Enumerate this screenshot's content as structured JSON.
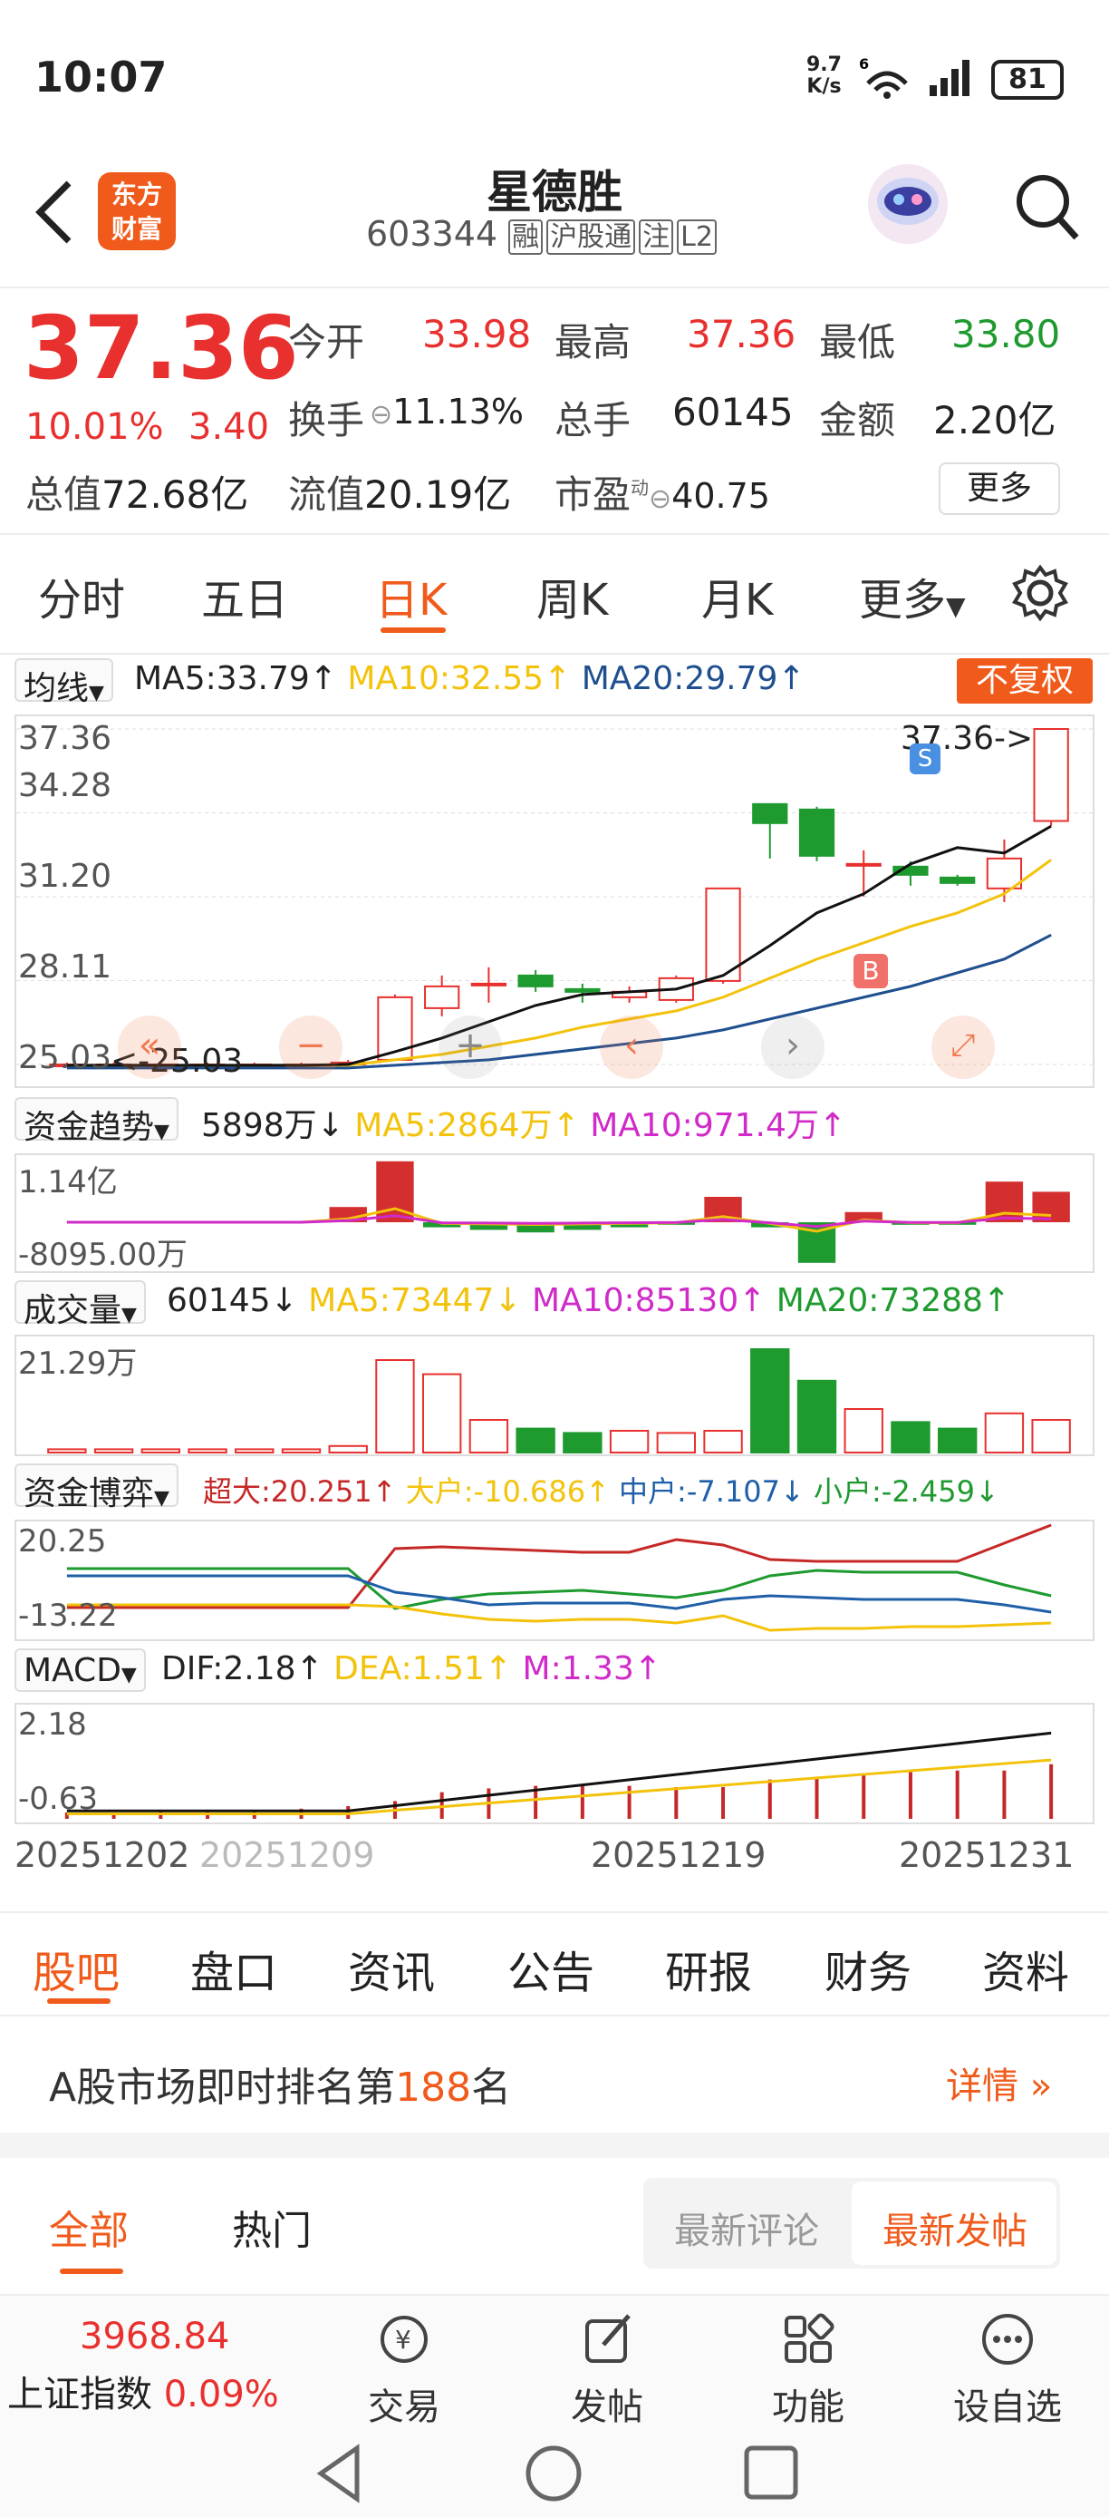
{
  "status": {
    "time": "10:07",
    "speed_top": "9.7",
    "speed_bottom": "K/s",
    "network": "6",
    "battery": "81"
  },
  "header": {
    "logo_line1": "东方",
    "logo_line2": "财富",
    "title": "星德胜",
    "code": "603344",
    "badges": [
      "融",
      "沪股通",
      "注",
      "L2"
    ]
  },
  "quote": {
    "price": "37.36",
    "change_pct": "10.01%",
    "change": "3.40",
    "open_label": "今开",
    "open": "33.98",
    "high_label": "最高",
    "high": "37.36",
    "low_label": "最低",
    "low": "33.80",
    "turnover_label": "换手",
    "turnover": "11.13%",
    "volume_label": "总手",
    "volume": "60145",
    "amount_label": "金额",
    "amount": "2.20亿",
    "mcap_label": "总值",
    "mcap": "72.68亿",
    "float_label": "流值",
    "float": "20.19亿",
    "pe_label": "市盈",
    "pe_sup": "动",
    "pe": "40.75",
    "more": "更多"
  },
  "period_tabs": [
    "分时",
    "五日",
    "日K",
    "周K",
    "月K",
    "更多"
  ],
  "ma": {
    "selector": "均线",
    "ma5": "MA5:33.79",
    "ma10": "MA10:32.55",
    "ma20": "MA20:29.79",
    "fq": "不复权",
    "prices": [
      "37.36",
      "34.28",
      "31.20",
      "28.11",
      "25.03"
    ],
    "last_label": "37.36->",
    "low_mark": "<-25.03",
    "buy": "B",
    "sell": "S"
  },
  "fund": {
    "selector": "资金趋势",
    "value": "5898万",
    "ma5": "MA5:2864万",
    "ma10": "MA10:971.4万",
    "top": "1.14亿",
    "bottom": "-8095.00万"
  },
  "vol": {
    "selector": "成交量",
    "value": "60145",
    "ma5": "MA5:73447",
    "ma10": "MA10:85130",
    "ma20": "MA20:73288",
    "top": "21.29万"
  },
  "game": {
    "selector": "资金博弈",
    "super": "超大:20.251",
    "big": "大户:-10.686",
    "mid": "中户:-7.107",
    "small": "小户:-2.459",
    "top": "20.25",
    "bottom": "-13.22"
  },
  "macd": {
    "selector": "MACD",
    "dif": "DIF:2.18",
    "dea": "DEA:1.51",
    "m": "M:1.33",
    "top": "2.18",
    "bottom": "-0.63"
  },
  "dates": [
    "20251202",
    "20251209",
    "20251219",
    "20251231"
  ],
  "chart_data": {
    "type": "candlestick",
    "candles": [
      {
        "o": 25.03,
        "h": 25.1,
        "l": 24.95,
        "c": 25.03
      },
      {
        "o": 25.03,
        "h": 25.1,
        "l": 24.95,
        "c": 25.03
      },
      {
        "o": 25.03,
        "h": 25.1,
        "l": 24.95,
        "c": 25.03
      },
      {
        "o": 25.03,
        "h": 25.1,
        "l": 24.95,
        "c": 25.03
      },
      {
        "o": 25.03,
        "h": 25.1,
        "l": 24.95,
        "c": 25.03
      },
      {
        "o": 25.03,
        "h": 25.1,
        "l": 24.95,
        "c": 25.03
      },
      {
        "o": 25.03,
        "h": 25.2,
        "l": 25.0,
        "c": 25.1
      },
      {
        "o": 25.2,
        "h": 27.6,
        "l": 25.2,
        "c": 27.5
      },
      {
        "o": 27.1,
        "h": 28.3,
        "l": 26.8,
        "c": 27.9
      },
      {
        "o": 28.0,
        "h": 28.6,
        "l": 27.3,
        "c": 28.0
      },
      {
        "o": 28.3,
        "h": 28.5,
        "l": 27.7,
        "c": 27.9
      },
      {
        "o": 27.8,
        "h": 28.0,
        "l": 27.3,
        "c": 27.7
      },
      {
        "o": 27.5,
        "h": 27.9,
        "l": 27.3,
        "c": 27.7
      },
      {
        "o": 27.4,
        "h": 28.3,
        "l": 27.3,
        "c": 28.2
      },
      {
        "o": 28.1,
        "h": 31.5,
        "l": 28.0,
        "c": 31.5
      },
      {
        "o": 34.6,
        "h": 34.6,
        "l": 32.6,
        "c": 33.9
      },
      {
        "o": 34.4,
        "h": 34.5,
        "l": 32.5,
        "c": 32.7
      },
      {
        "o": 32.4,
        "h": 32.9,
        "l": 31.2,
        "c": 32.4
      },
      {
        "o": 32.3,
        "h": 32.5,
        "l": 31.6,
        "c": 32.0
      },
      {
        "o": 31.9,
        "h": 32.0,
        "l": 31.6,
        "c": 31.7
      },
      {
        "o": 31.5,
        "h": 33.3,
        "l": 31.0,
        "c": 32.6
      },
      {
        "o": 33.98,
        "h": 37.36,
        "l": 33.8,
        "c": 37.36
      }
    ],
    "ma5": [
      25.0,
      25.0,
      25.0,
      25.0,
      25.0,
      25.0,
      25.03,
      25.5,
      26.0,
      26.6,
      27.2,
      27.6,
      27.7,
      27.8,
      28.3,
      29.4,
      30.6,
      31.3,
      32.4,
      33.0,
      32.8,
      33.79
    ],
    "ma10": [
      25.0,
      25.0,
      25.0,
      25.0,
      25.0,
      25.0,
      25.0,
      25.2,
      25.4,
      25.7,
      26.0,
      26.4,
      26.7,
      27.0,
      27.5,
      28.2,
      28.9,
      29.5,
      30.1,
      30.6,
      31.3,
      32.55
    ],
    "ma20": [
      24.9,
      24.9,
      24.9,
      24.9,
      24.9,
      24.9,
      24.9,
      25.0,
      25.1,
      25.2,
      25.4,
      25.6,
      25.8,
      26.0,
      26.3,
      26.7,
      27.1,
      27.5,
      27.9,
      28.4,
      28.9,
      29.79
    ],
    "ylim": [
      25.03,
      37.36
    ],
    "x_ticks": [
      "20251202",
      "20251209",
      "20251219",
      "20251231"
    ]
  },
  "bottom_tabs": [
    "股吧",
    "盘口",
    "资讯",
    "公告",
    "研报",
    "财务",
    "资料"
  ],
  "rank": {
    "prefix": "A股市场即时排名第",
    "num": "188",
    "suffix": "名",
    "detail": "详情"
  },
  "sub_tabs": {
    "all": "全部",
    "hot": "热门",
    "latest_comment": "最新评论",
    "latest_post": "最新发帖"
  },
  "index": {
    "value": "3968.84",
    "name": "上证指数",
    "pct": "0.09%"
  },
  "nav": [
    "交易",
    "发帖",
    "功能",
    "设自选"
  ],
  "colors": {
    "up": "#e8302e",
    "down": "#1e9a2f",
    "accent": "#f05a1a"
  }
}
